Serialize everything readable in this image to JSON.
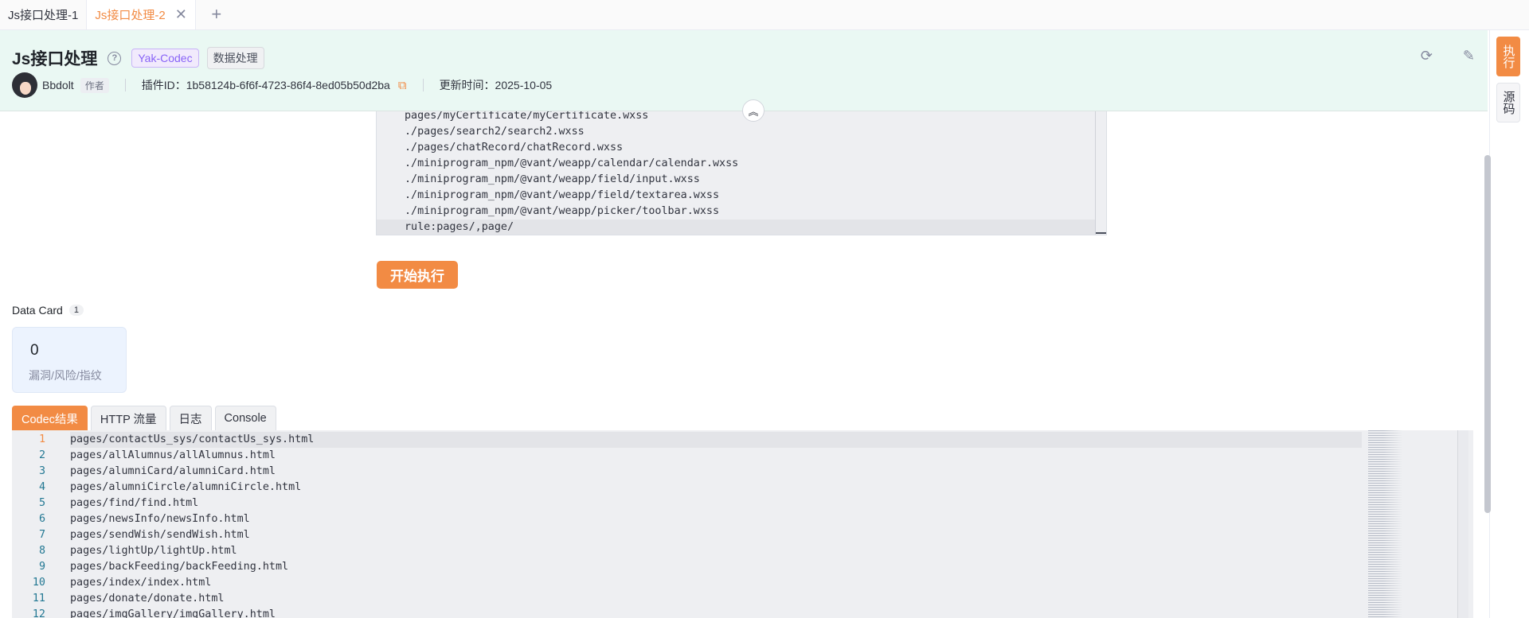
{
  "tabs": [
    {
      "label": "Js接口处理-1",
      "active": false
    },
    {
      "label": "Js接口处理-2",
      "active": true
    }
  ],
  "tab_add_label": "+",
  "plugin": {
    "title": "Js接口处理",
    "tags": [
      "Yak-Codec",
      "数据处理"
    ],
    "author": "Bbdolt",
    "author_badge": "作者",
    "plugin_id_text": "插件ID：1b58124b-6f6f-4723-86f4-8ed05b50d2ba",
    "updated_text": "更新时间：2025-10-05"
  },
  "side_buttons": {
    "run": "执行",
    "source": "源码"
  },
  "input_code": [
    "pages/myCertificate/myCertificate.wxss",
    "./pages/search2/search2.wxss",
    "./pages/chatRecord/chatRecord.wxss",
    "./miniprogram_npm/@vant/weapp/calendar/calendar.wxss",
    "./miniprogram_npm/@vant/weapp/field/input.wxss",
    "./miniprogram_npm/@vant/weapp/field/textarea.wxss",
    "./miniprogram_npm/@vant/weapp/picker/toolbar.wxss",
    "rule:pages/,page/"
  ],
  "start_button": "开始执行",
  "data_card": {
    "title": "Data Card",
    "count": "1",
    "value": "0",
    "label": "漏洞/风险/指纹"
  },
  "result_tabs": [
    "Codec结果",
    "HTTP 流量",
    "日志",
    "Console"
  ],
  "result_lines": [
    "pages/contactUs_sys/contactUs_sys.html",
    "pages/allAlumnus/allAlumnus.html",
    "pages/alumniCard/alumniCard.html",
    "pages/alumniCircle/alumniCircle.html",
    "pages/find/find.html",
    "pages/newsInfo/newsInfo.html",
    "pages/sendWish/sendWish.html",
    "pages/lightUp/lightUp.html",
    "pages/backFeeding/backFeeding.html",
    "pages/index/index.html",
    "pages/donate/donate.html",
    "pages/imgGallery/imgGallery.html"
  ],
  "colors": {
    "accent": "#f28b44",
    "header_bg": "#eaf8f3",
    "tag_purple": "#8863f7"
  }
}
